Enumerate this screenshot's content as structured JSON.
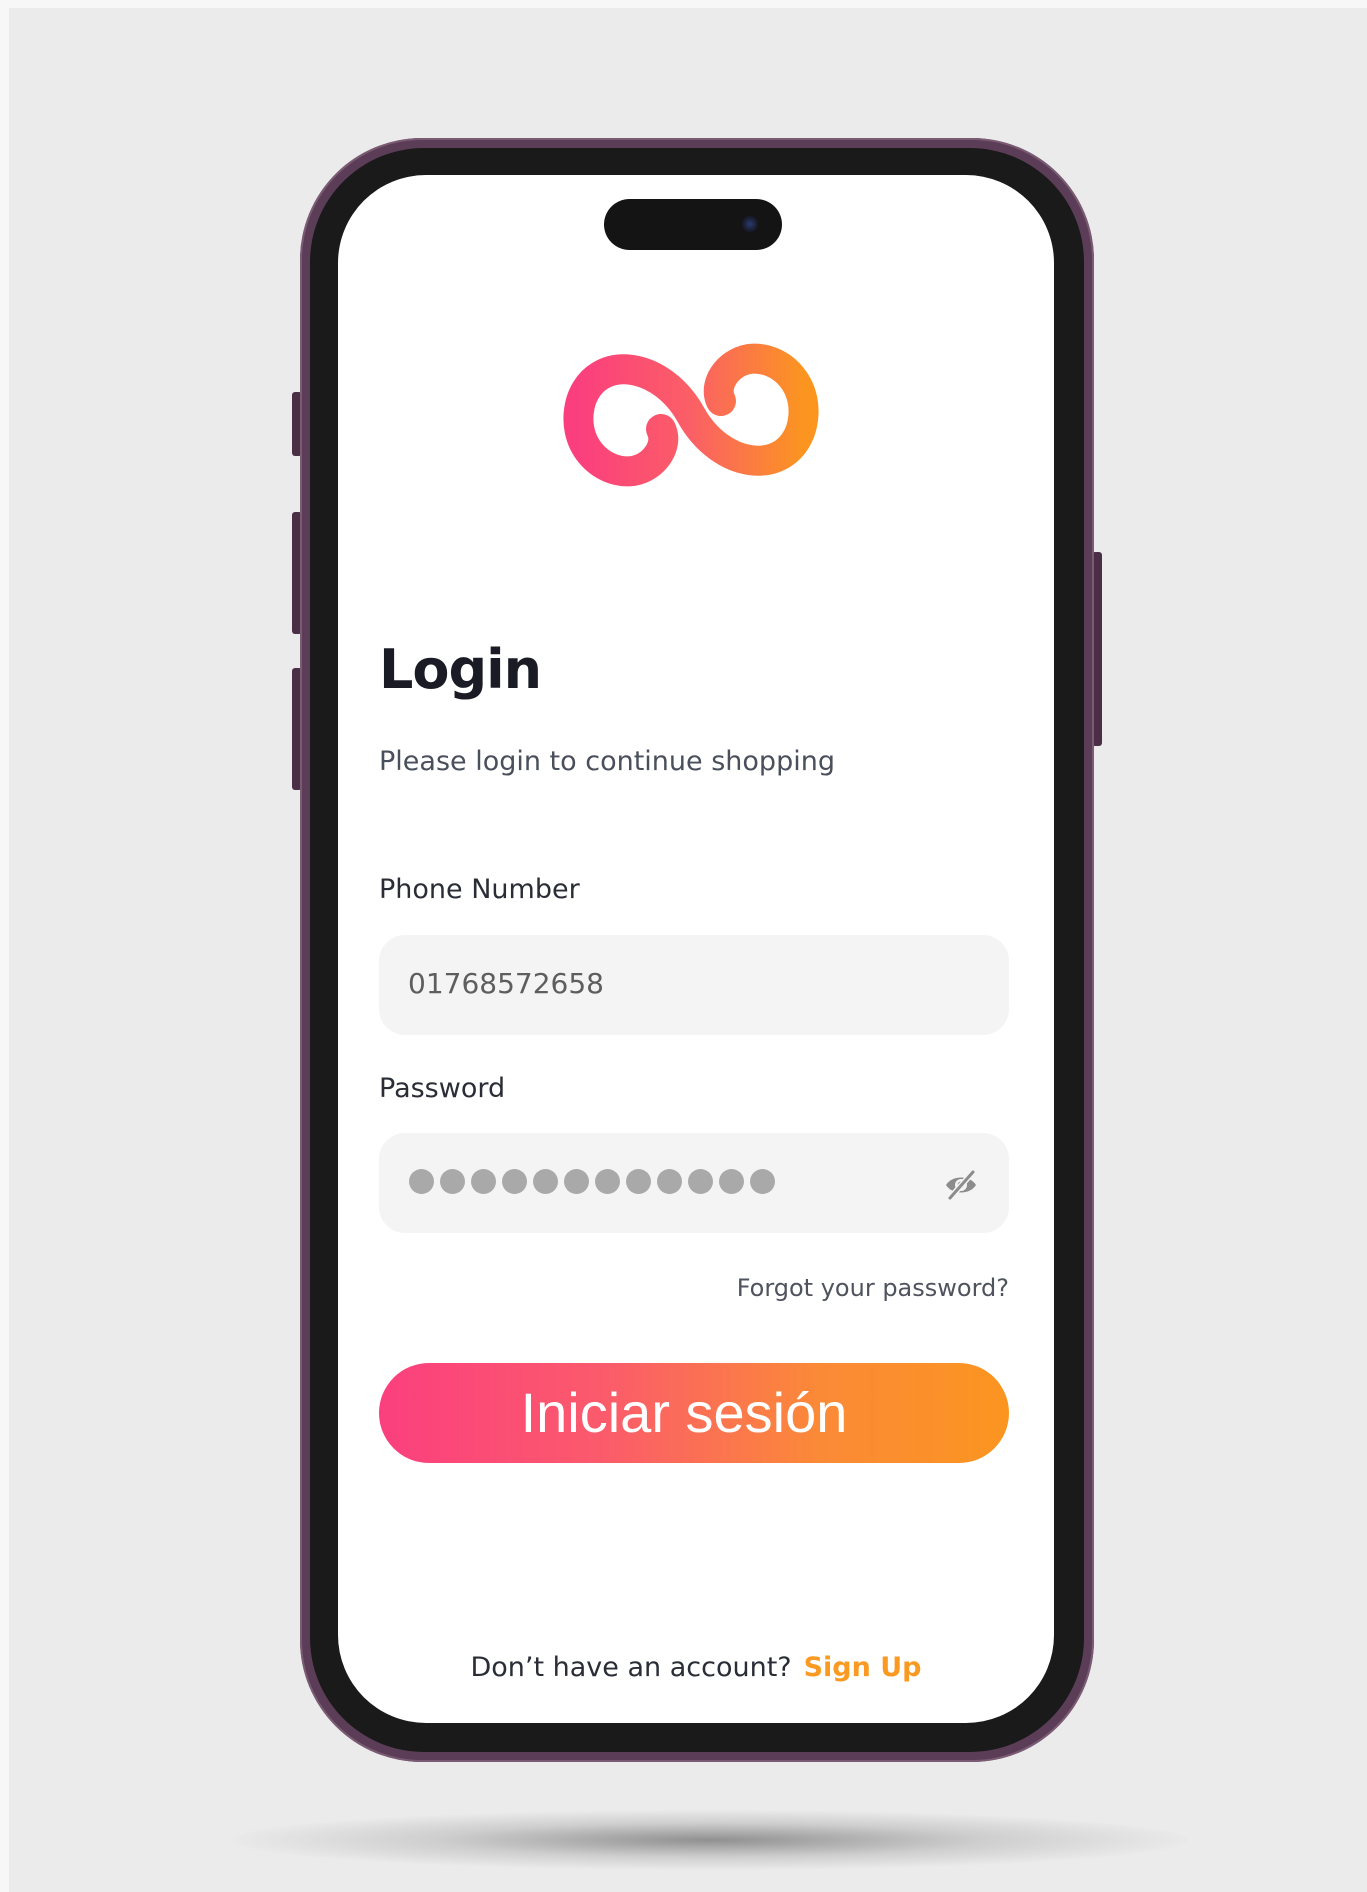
{
  "login": {
    "title": "Login",
    "subtitle": "Please login to continue shopping",
    "phone": {
      "label": "Phone Number",
      "value": "01768572658"
    },
    "password": {
      "label": "Password",
      "mask_count": 12
    },
    "forgot_link": "Forgot your password?",
    "submit_label": "Iniciar sesión",
    "signup_prompt": "Don’t have an account?",
    "signup_link": "Sign Up"
  },
  "icons": {
    "logo": "infinity-logo-icon",
    "password_toggle": "eye-slash-icon"
  },
  "colors": {
    "gradient_start": "#fb3f7e",
    "gradient_end": "#fb9520",
    "link_accent": "#fb9a22",
    "phone_frame": "#5c3d57"
  }
}
